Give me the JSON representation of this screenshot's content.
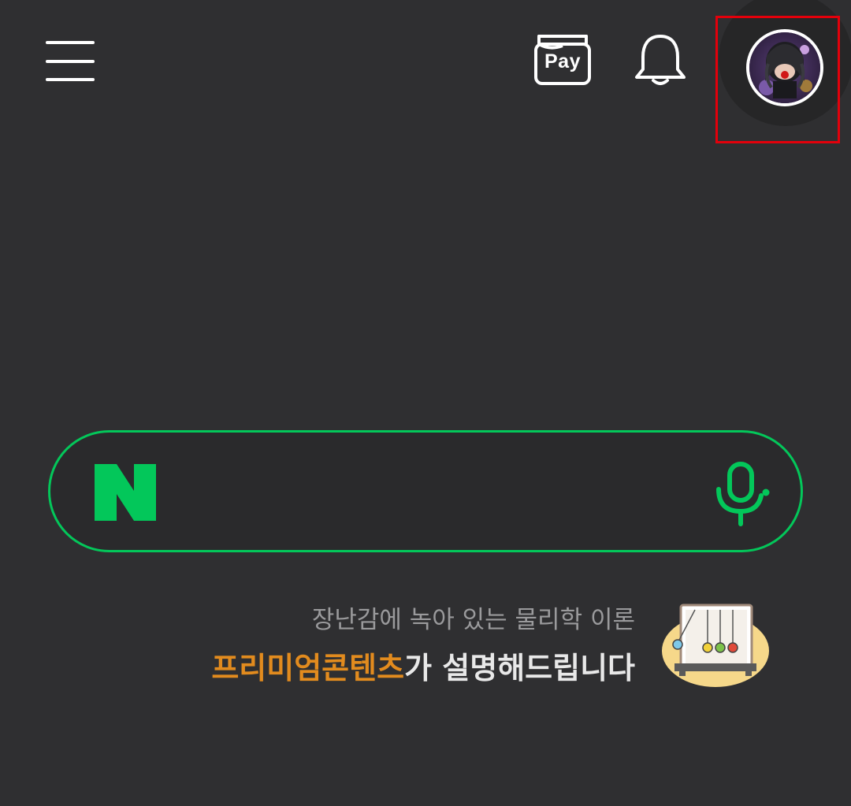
{
  "header": {
    "menu_icon": "hamburger-menu-icon",
    "pay_label": "Pay",
    "notification_icon": "bell-icon",
    "profile_icon": "avatar"
  },
  "search": {
    "logo_text": "N",
    "value": "",
    "placeholder": "",
    "mic_icon": "microphone-icon"
  },
  "promo": {
    "line1": "장난감에 녹아 있는 물리학 이론",
    "highlight": "프리미엄콘텐츠",
    "line2_rest": "가 설명해드립니다",
    "image_icon": "newtons-cradle-illustration"
  },
  "colors": {
    "background": "#2f2f31",
    "accent_green": "#03c75a",
    "promo_orange": "#e28b1e",
    "highlight_red": "#e3000b"
  }
}
